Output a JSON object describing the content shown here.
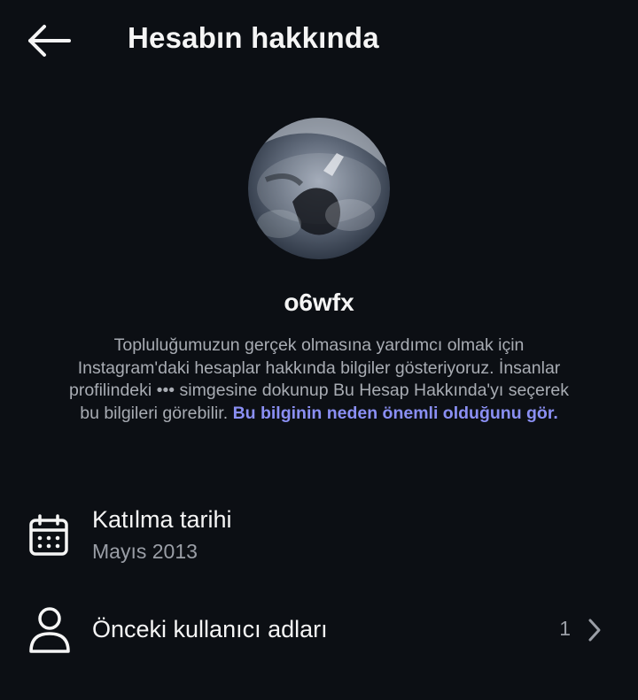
{
  "header": {
    "back_icon": "arrow-left-icon",
    "title": "Hesabın hakkında"
  },
  "profile": {
    "username": "o6wfx",
    "avatar": "profile-photo"
  },
  "info": {
    "text": "Topluluğumuzun gerçek olmasına yardımcı olmak için Instagram'daki hesaplar hakkında bilgiler gösteriyoruz. İnsanlar profilindeki ••• simgesine dokunup Bu Hesap Hakkında'yı seçerek bu bilgileri görebilir.",
    "link": "Bu bilginin neden önemli olduğunu gör.",
    "link_color": "#8a8ff3"
  },
  "joined": {
    "icon": "calendar-icon",
    "label": "Katılma tarihi",
    "value": "Mayıs 2013"
  },
  "former_usernames": {
    "icon": "person-icon",
    "label": "Önceki kullanıcı adları",
    "count": "1",
    "chevron_icon": "chevron-right-icon"
  },
  "colors": {
    "background": "#0c0f14",
    "primary_text": "#f5f5f5",
    "secondary_text": "#9a9ea6"
  }
}
